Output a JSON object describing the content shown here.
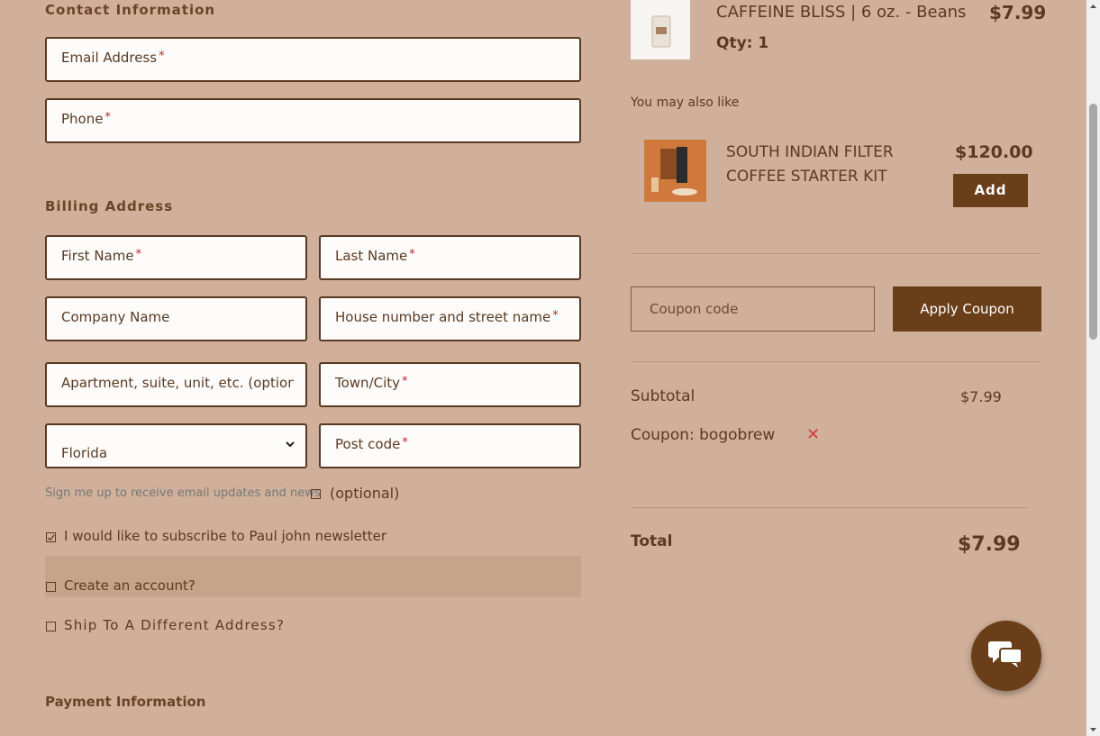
{
  "contact": {
    "title": "Contact Information",
    "email_placeholder": "Email Address",
    "phone_placeholder": "Phone",
    "required_mark": "*"
  },
  "billing": {
    "title": "Billing Address",
    "first_name": "First Name",
    "last_name": "Last Name",
    "company": "Company Name",
    "street": "House number and street name",
    "apartment": "Apartment, suite, unit, etc. (option",
    "town": "Town/City",
    "state_selected": "Florida",
    "postcode": "Post code"
  },
  "optin": {
    "email_updates_label": "Sign me up to receive email updates and news",
    "optional": "(optional)",
    "newsletter_label": "I would like to subscribe to Paul john newsletter",
    "newsletter_checked": true,
    "create_account_label": "Create an account?",
    "ship_different_label": "Ship To A Different Address?"
  },
  "payment": {
    "title": "Payment Information"
  },
  "cart": {
    "item_name": "CAFFEINE BLISS | 6 oz. - Beans",
    "item_price": "$7.99",
    "item_qty": "Qty: 1"
  },
  "upsell": {
    "title": "You may also like",
    "product_name_line1": "SOUTH INDIAN FILTER",
    "product_name_line2": "COFFEE STARTER KIT",
    "product_price": "$120.00",
    "add_label": "Add"
  },
  "coupon": {
    "placeholder": "Coupon code",
    "apply_label": "Apply Coupon"
  },
  "totals": {
    "subtotal_label": "Subtotal",
    "subtotal_value": "$7.99",
    "coupon_label": "Coupon: bogobrew",
    "remove_symbol": "✕",
    "total_label": "Total",
    "total_value": "$7.99"
  },
  "colors": {
    "background": "#d0b09a",
    "brand_brown": "#6b3e1a",
    "required_red": "#c0262b"
  }
}
